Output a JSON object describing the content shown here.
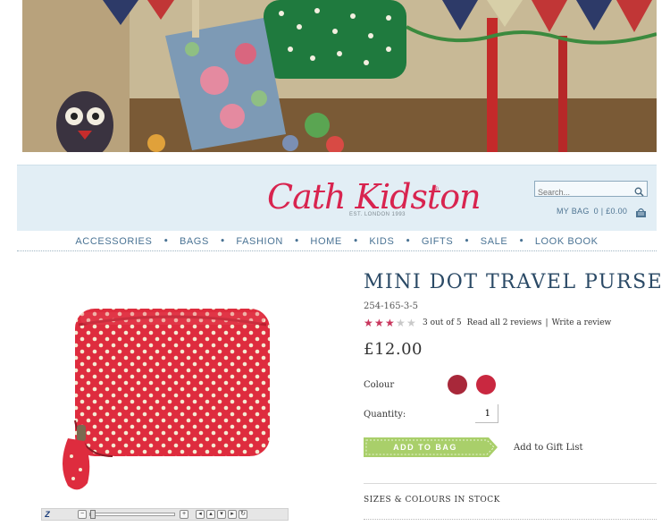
{
  "hero": {
    "alt": ""
  },
  "header": {
    "logo_text": "Cath Kidston",
    "logo_reg": "®",
    "logo_sub": "EST. LONDON 1993",
    "search_placeholder": "Search...",
    "mybag_label": "MY BAG",
    "mybag_value": "0 | £0.00"
  },
  "nav": {
    "items": [
      "ACCESSORIES",
      "BAGS",
      "FASHION",
      "HOME",
      "KIDS",
      "GIFTS",
      "SALE",
      "LOOK BOOK"
    ],
    "separator": "•"
  },
  "zoom": {
    "label": "Z",
    "minus": "−",
    "plus": "+"
  },
  "product": {
    "title": "MINI DOT TRAVEL PURSE",
    "sku": "254-165-3-5",
    "rating_value": 3,
    "rating_max": 5,
    "rating_text": "3 out of 5",
    "read_reviews": "Read all 2 reviews",
    "rating_sep": "|",
    "write_review": "Write a review",
    "price": "£12.00",
    "colour_label": "Colour",
    "swatches": [
      "#a8283a",
      "#c92840"
    ],
    "quantity_label": "Quantity:",
    "quantity_value": "1",
    "add_to_bag": "ADD TO BAG",
    "add_to_gift": "Add to Gift List",
    "sizes_heading": "SIZES & COLOURS IN STOCK"
  },
  "colors": {
    "brand": "#d8244f",
    "nav": "#4a7394",
    "header_bg": "#e2eef5",
    "button": "#a9cf6a"
  }
}
